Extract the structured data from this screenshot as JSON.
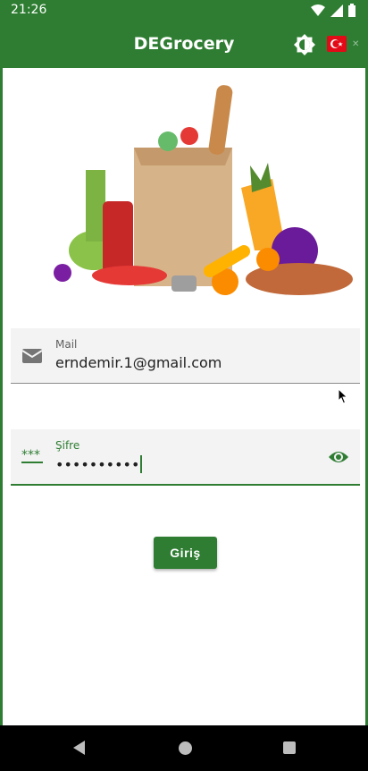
{
  "status_bar": {
    "time": "21:26"
  },
  "app_bar": {
    "title": "DEGrocery"
  },
  "login_form": {
    "mail": {
      "label": "Mail",
      "value": "erndemir.1@gmail.com"
    },
    "password": {
      "label": "Şifre",
      "value": "••••••••••"
    },
    "submit_label": "Giriş"
  },
  "colors": {
    "primary": "#2e7d32",
    "field_bg": "#f3f3f3",
    "nav": "#000000"
  },
  "icons": [
    "wifi-icon",
    "signal-icon",
    "battery-icon",
    "brightness-icon",
    "turkey-flag-icon",
    "mail-icon",
    "password-dots-icon",
    "visibility-icon",
    "back-icon",
    "home-icon",
    "recents-icon"
  ]
}
